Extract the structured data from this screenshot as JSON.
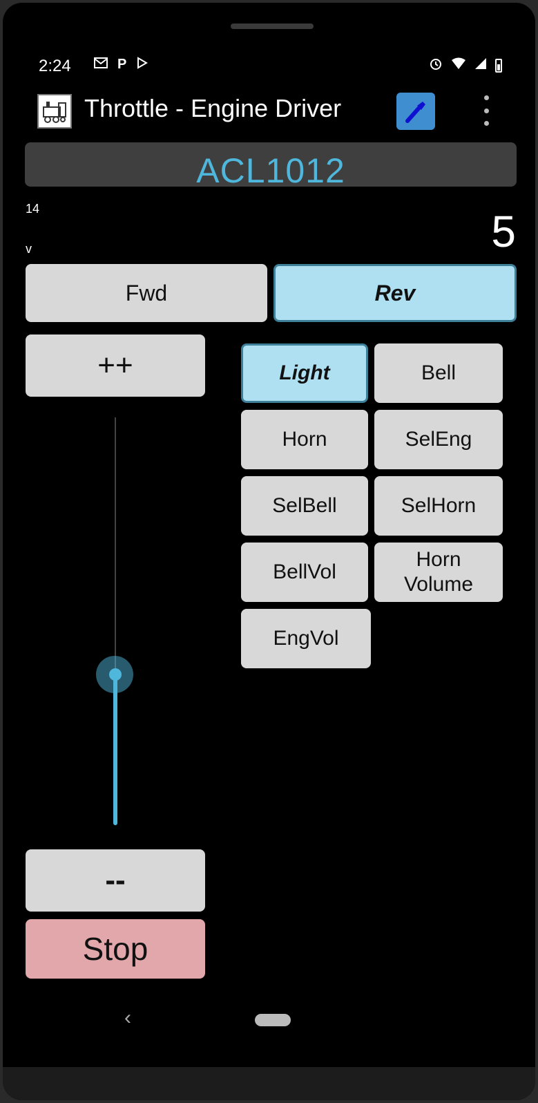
{
  "status_bar": {
    "time": "2:24",
    "left_icons": [
      "gmail-icon",
      "parking-icon",
      "play-store-icon"
    ],
    "right_icons": [
      "alarm-icon",
      "wifi-icon",
      "signal-icon",
      "battery-icon"
    ]
  },
  "app_bar": {
    "title": "Throttle - Engine Driver",
    "logo_icon": "locomotive-icon",
    "action_icon": "wrench-icon",
    "overflow_icon": "more-vert-icon",
    "action_color": "#3f8fd0"
  },
  "loco": {
    "name": "ACL1012",
    "color": "#4fb6dc"
  },
  "speed": {
    "steps_label": "14",
    "unit_label": "v",
    "value": "5",
    "slider_fraction": 0.63
  },
  "direction": {
    "forward_label": "Fwd",
    "reverse_label": "Rev",
    "selected": "Rev"
  },
  "throttle_buttons": {
    "increase_label": "++",
    "decrease_label": "--",
    "stop_label": "Stop",
    "stop_color": "#e2a7aa"
  },
  "functions": {
    "light": "Light",
    "bell": "Bell",
    "horn": "Horn",
    "sel_eng": "SelEng",
    "sel_bell": "SelBell",
    "sel_horn": "SelHorn",
    "bell_vol": "BellVol",
    "horn_volume": "Horn Volume",
    "eng_vol": "EngVol",
    "active": [
      "Light"
    ],
    "active_color": "#aee0f2"
  },
  "nav_bar": {
    "back_icon": "back-chevron-icon",
    "home_icon": "home-pill-icon"
  }
}
